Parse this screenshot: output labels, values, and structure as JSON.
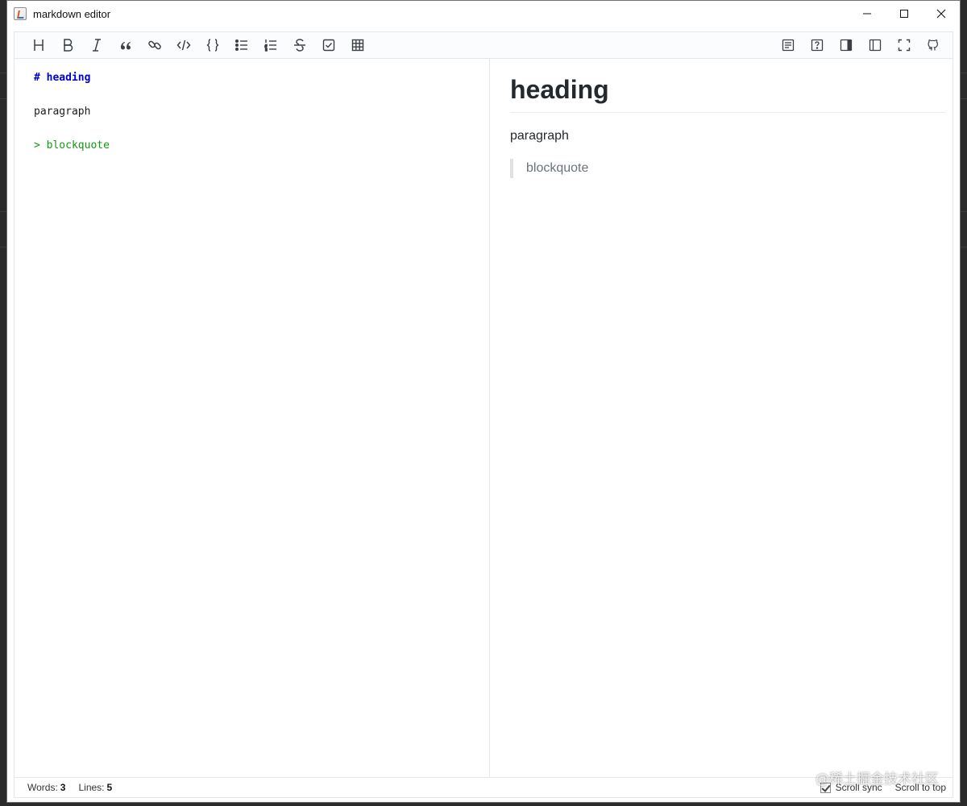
{
  "window": {
    "title": "markdown editor",
    "controls": [
      "minimize-icon",
      "maximize-icon",
      "close-icon"
    ]
  },
  "toolbar": {
    "left": [
      {
        "name": "heading",
        "icon": "heading-icon"
      },
      {
        "name": "bold",
        "icon": "bold-icon"
      },
      {
        "name": "italic",
        "icon": "italic-icon"
      },
      {
        "name": "quote",
        "icon": "quote-icon"
      },
      {
        "name": "link",
        "icon": "link-icon"
      },
      {
        "name": "code",
        "icon": "code-icon"
      },
      {
        "name": "code-block",
        "icon": "code-block-icon"
      },
      {
        "name": "unordered-list",
        "icon": "unordered-list-icon"
      },
      {
        "name": "ordered-list",
        "icon": "ordered-list-icon"
      },
      {
        "name": "strikethrough",
        "icon": "strikethrough-icon"
      },
      {
        "name": "task-list",
        "icon": "checkbox-icon"
      },
      {
        "name": "table",
        "icon": "table-icon"
      }
    ],
    "right": [
      {
        "name": "toc",
        "icon": "toc-icon"
      },
      {
        "name": "help",
        "icon": "help-icon"
      },
      {
        "name": "preview-only",
        "icon": "preview-panel-icon"
      },
      {
        "name": "editor-only",
        "icon": "editor-panel-icon"
      },
      {
        "name": "fullscreen",
        "icon": "fullscreen-icon"
      },
      {
        "name": "github",
        "icon": "github-icon"
      }
    ]
  },
  "editor": {
    "lines": [
      {
        "text": "# heading",
        "style": "heading"
      },
      {
        "text": "",
        "style": "text"
      },
      {
        "text": "paragraph",
        "style": "text"
      },
      {
        "text": "",
        "style": "text"
      },
      {
        "text": "> blockquote",
        "style": "quote"
      }
    ]
  },
  "preview": {
    "h1": "heading",
    "paragraph": "paragraph",
    "blockquote": "blockquote"
  },
  "status": {
    "words_label": "Words:",
    "words_value": "3",
    "lines_label": "Lines:",
    "lines_value": "5",
    "scroll_sync_label": "Scroll sync",
    "scroll_sync_checked": true,
    "scroll_top_label": "Scroll to top"
  },
  "watermark": "@稀土掘金技术社区",
  "colors": {
    "heading": "#0000cc",
    "quote": "#119911",
    "preview_text": "#24292e",
    "quote_border": "#dfe2e5"
  }
}
